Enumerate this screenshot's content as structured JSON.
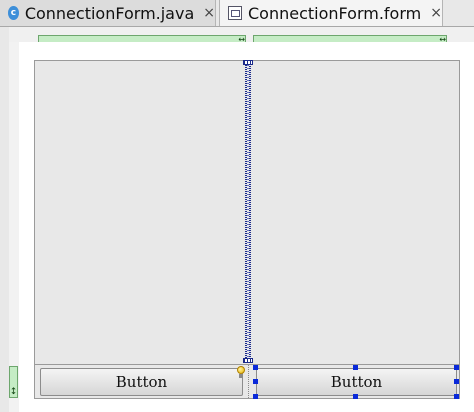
{
  "tabs": [
    {
      "label": "ConnectionForm.java",
      "icon": "java-class-icon",
      "active": false
    },
    {
      "label": "ConnectionForm.form",
      "icon": "form-file-icon",
      "active": true
    }
  ],
  "tab_close_glyph": "×",
  "header_glyph": "↔",
  "row_header_glyph": "↕",
  "form": {
    "buttons": [
      {
        "label": "Button",
        "selected": false
      },
      {
        "label": "Button",
        "selected": true
      }
    ]
  },
  "colors": {
    "header_green": "#c5ecc5",
    "selection_blue": "#0a29d9",
    "splitter_blue": "#1b2a8a",
    "panel_gray": "#e8e8e8"
  }
}
